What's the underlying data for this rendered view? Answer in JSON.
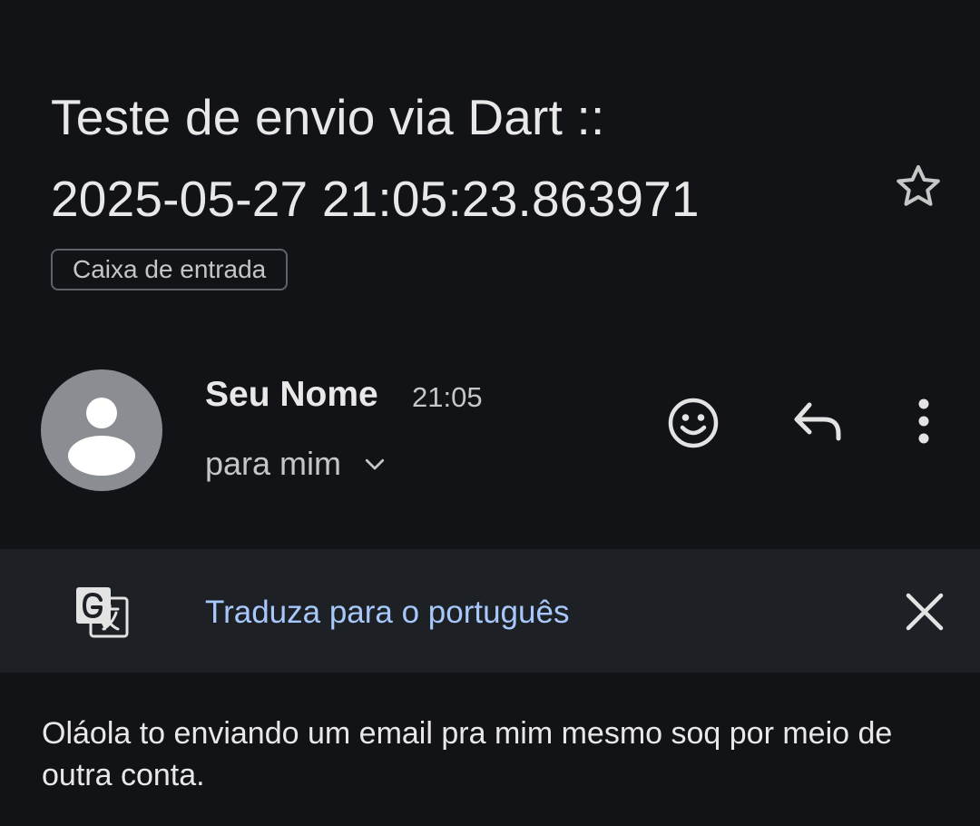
{
  "email": {
    "subject_line1": "Teste de envio via Dart ::",
    "subject_line2": "2025-05-27 21:05:23.863971",
    "label": "Caixa de entrada",
    "sender_name": "Seu Nome",
    "time": "21:05",
    "recipient": "para mim",
    "body": "Oláola to enviando um email pra mim mesmo soq por meio de outra conta."
  },
  "translate_bar": {
    "link_text": "Traduza para o português"
  },
  "icons": {
    "star": "star-outline-icon",
    "avatar": "person-icon",
    "expand": "chevron-down-icon",
    "emoji": "smiley-icon",
    "reply": "reply-icon",
    "more": "more-vert-icon",
    "translate": "google-translate-icon",
    "close": "close-icon"
  },
  "colors": {
    "background": "#121316",
    "translate_bar_bg": "#1d2126",
    "link": "#a8c7fa",
    "avatar_bg": "#8a8d91"
  }
}
